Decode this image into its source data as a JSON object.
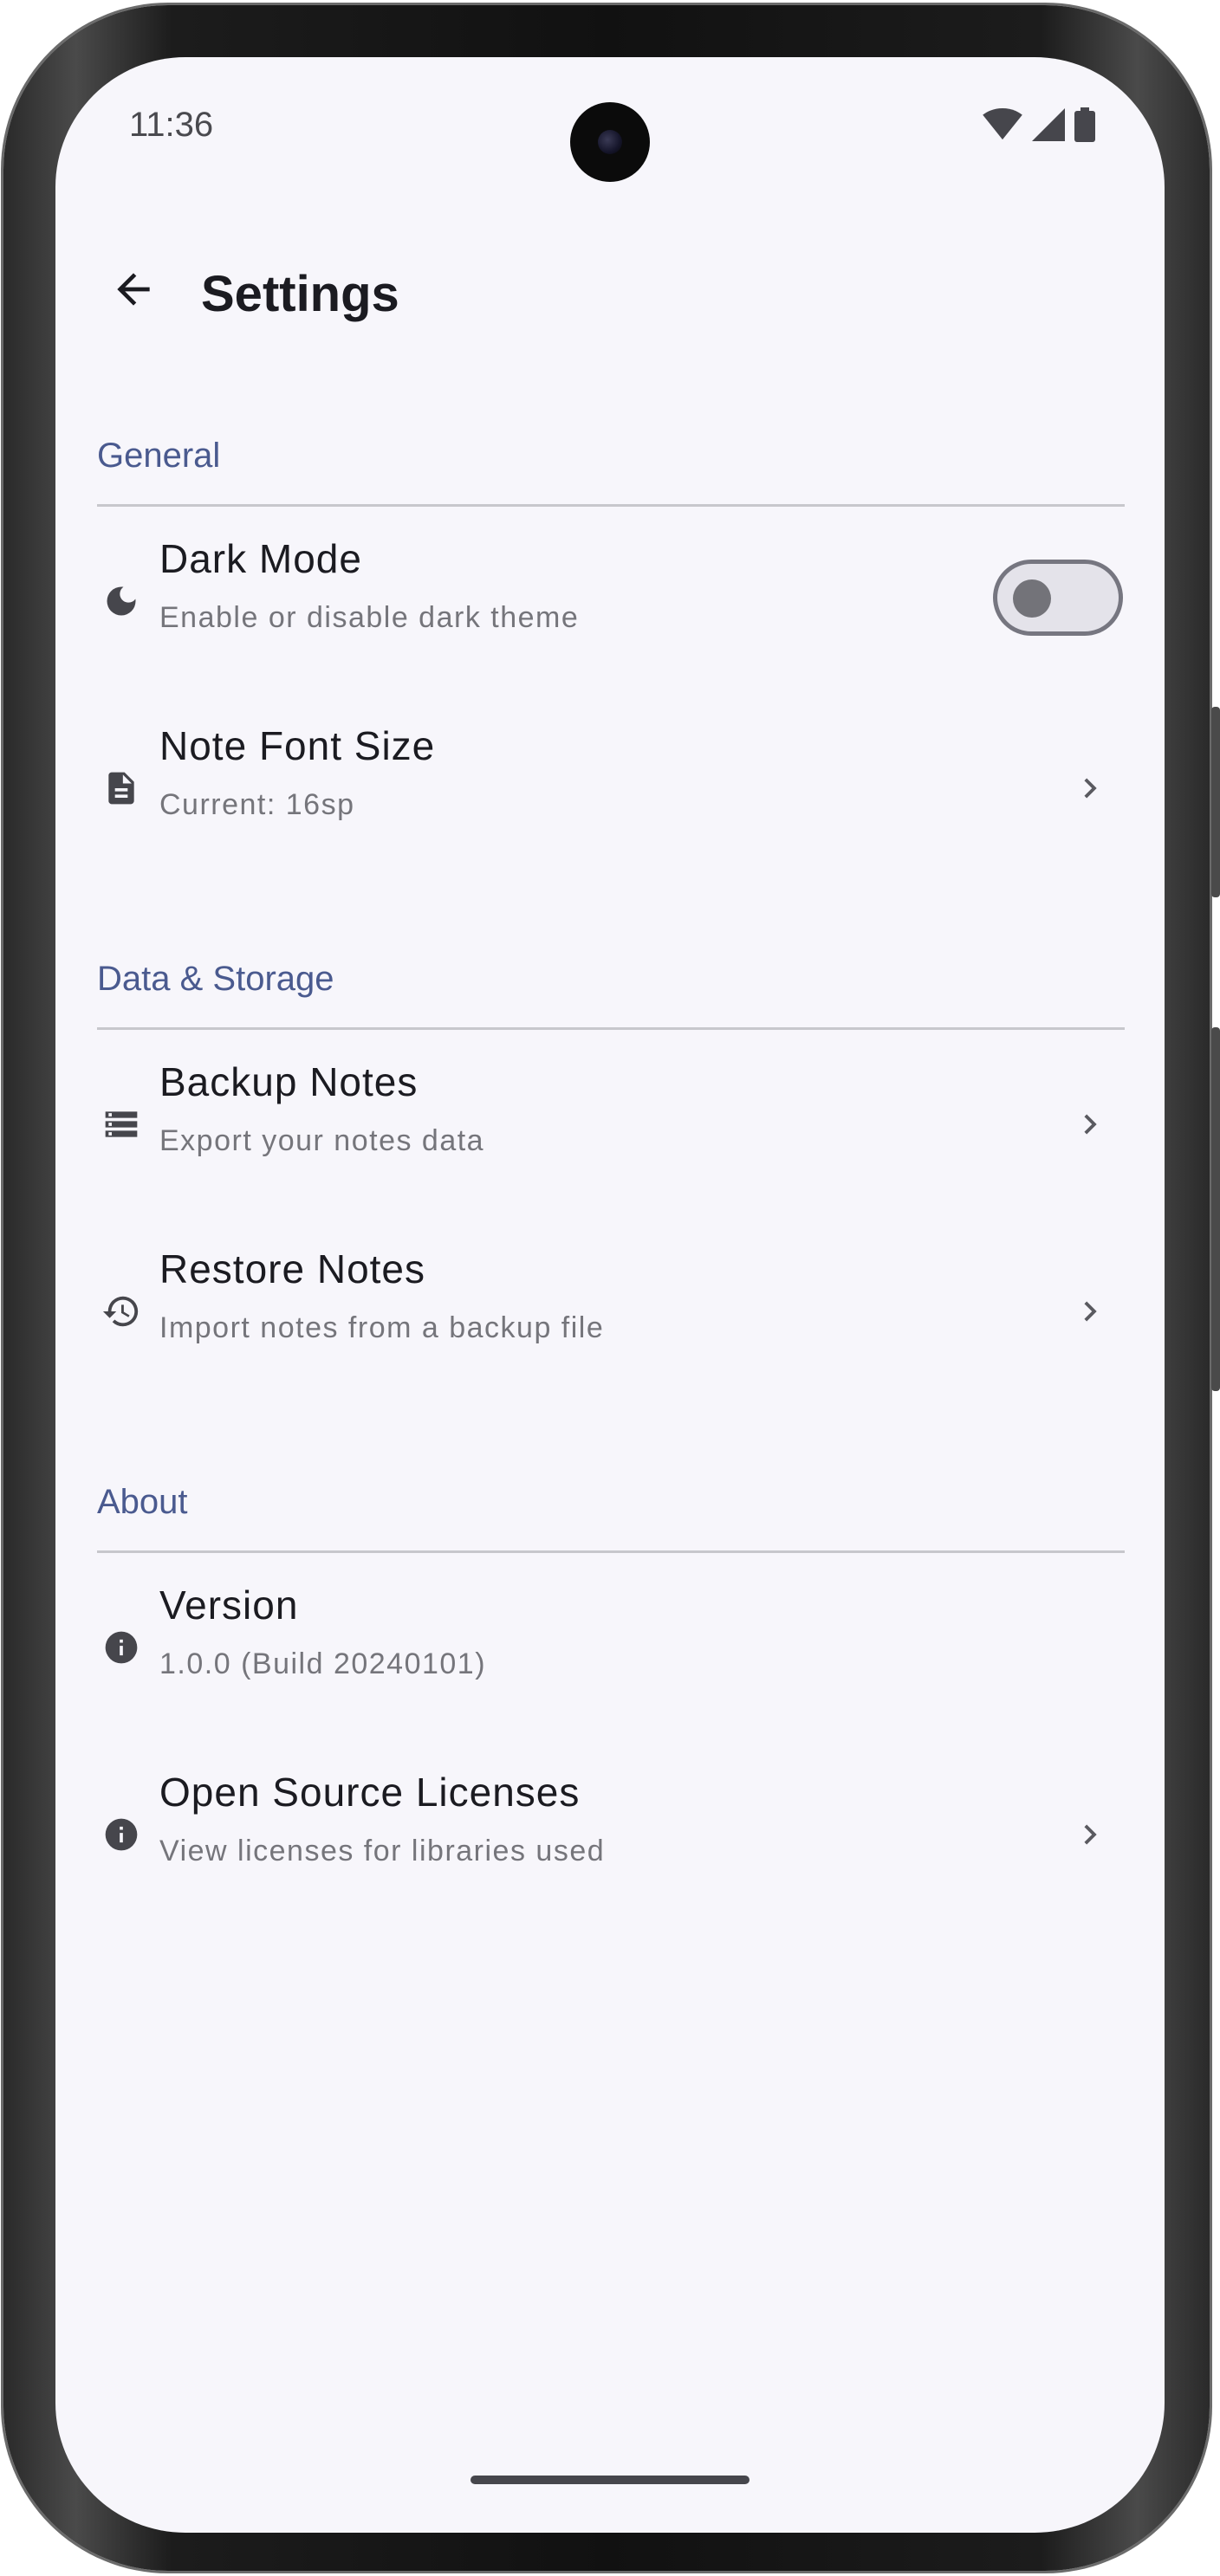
{
  "status_bar": {
    "time": "11:36",
    "icons": [
      "wifi-icon",
      "cellular-signal-icon",
      "battery-icon"
    ]
  },
  "top_bar": {
    "title": "Settings",
    "back_icon": "arrow-back-icon"
  },
  "sections": [
    {
      "header": "General",
      "items": [
        {
          "icon": "moon-icon",
          "title": "Dark Mode",
          "subtitle": "Enable or disable dark theme",
          "control": "toggle",
          "toggle_on": false
        },
        {
          "icon": "document-icon",
          "title": "Note Font Size",
          "subtitle": "Current: 16sp",
          "control": "chevron"
        }
      ]
    },
    {
      "header": "Data & Storage",
      "items": [
        {
          "icon": "storage-icon",
          "title": "Backup Notes",
          "subtitle": "Export your notes data",
          "control": "chevron"
        },
        {
          "icon": "history-icon",
          "title": "Restore Notes",
          "subtitle": "Import notes from a backup file",
          "control": "chevron"
        }
      ]
    },
    {
      "header": "About",
      "items": [
        {
          "icon": "info-icon",
          "title": "Version",
          "subtitle": "1.0.0 (Build 20240101)",
          "control": "none"
        },
        {
          "icon": "info-icon",
          "title": "Open Source Licenses",
          "subtitle": "View licenses for libraries used",
          "control": "chevron"
        }
      ]
    }
  ],
  "colors": {
    "background": "#f7f6fb",
    "section_header": "#4a5a8f",
    "title_text": "#1b1b21",
    "subtitle_text": "#75757b",
    "icon": "#46464c"
  }
}
